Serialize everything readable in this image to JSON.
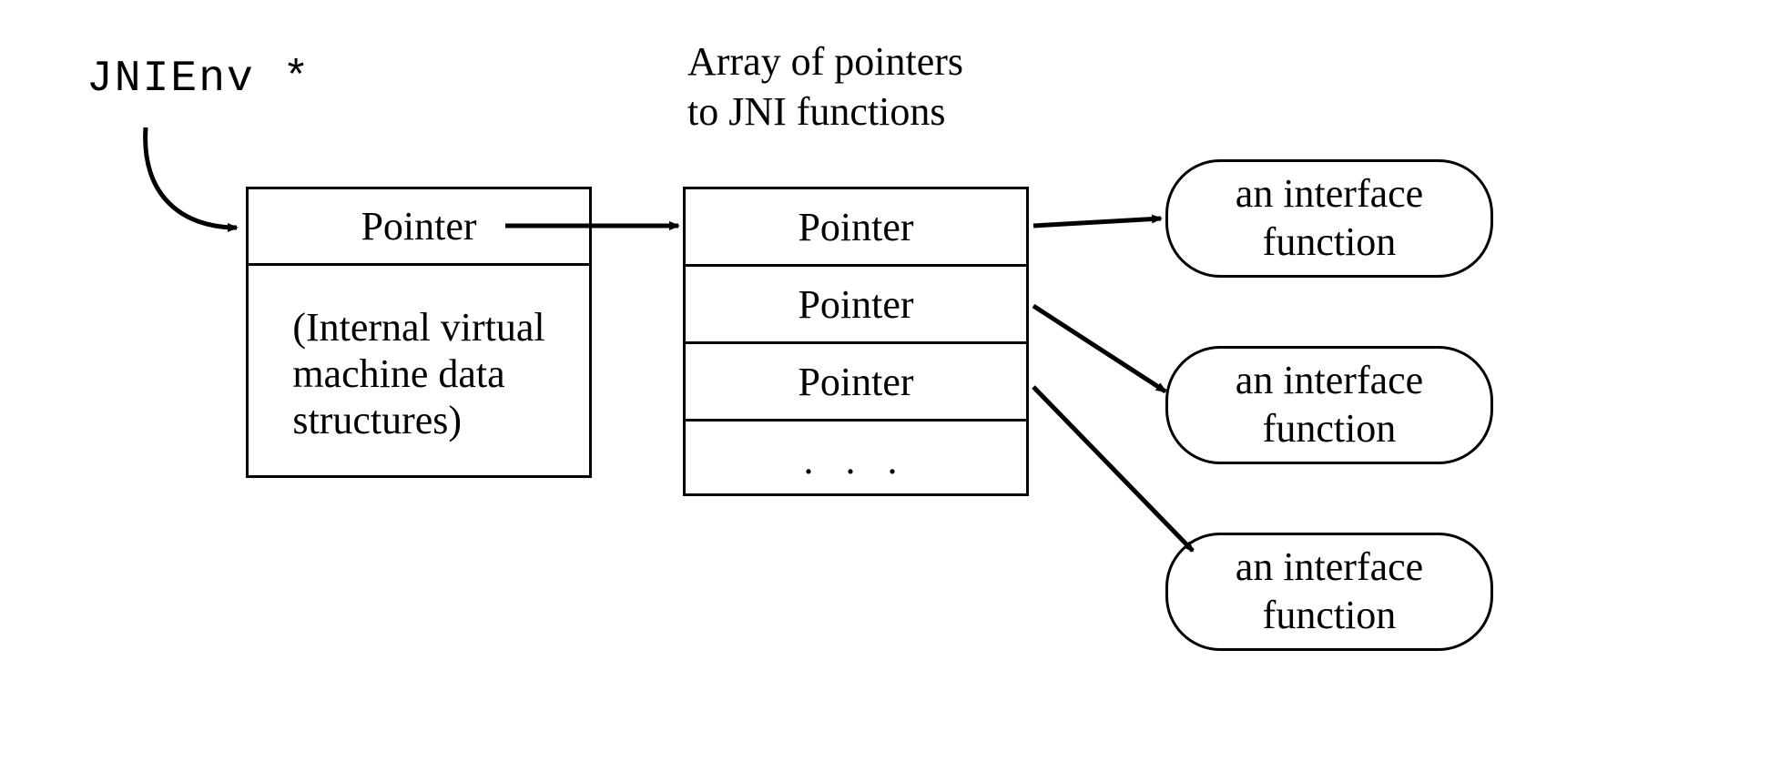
{
  "env_label": "JNIEnv *",
  "array_title_line1": "Array of pointers",
  "array_title_line2": "to  JNI functions",
  "jnienv_box": {
    "pointer_label": "Pointer",
    "internal_label": "(Internal virtual\nmachine data\nstructures)"
  },
  "pointer_array": {
    "rows": [
      "Pointer",
      "Pointer",
      "Pointer",
      ".  .  ."
    ]
  },
  "interface_functions": {
    "label": "an interface\nfunction",
    "count": 3
  }
}
